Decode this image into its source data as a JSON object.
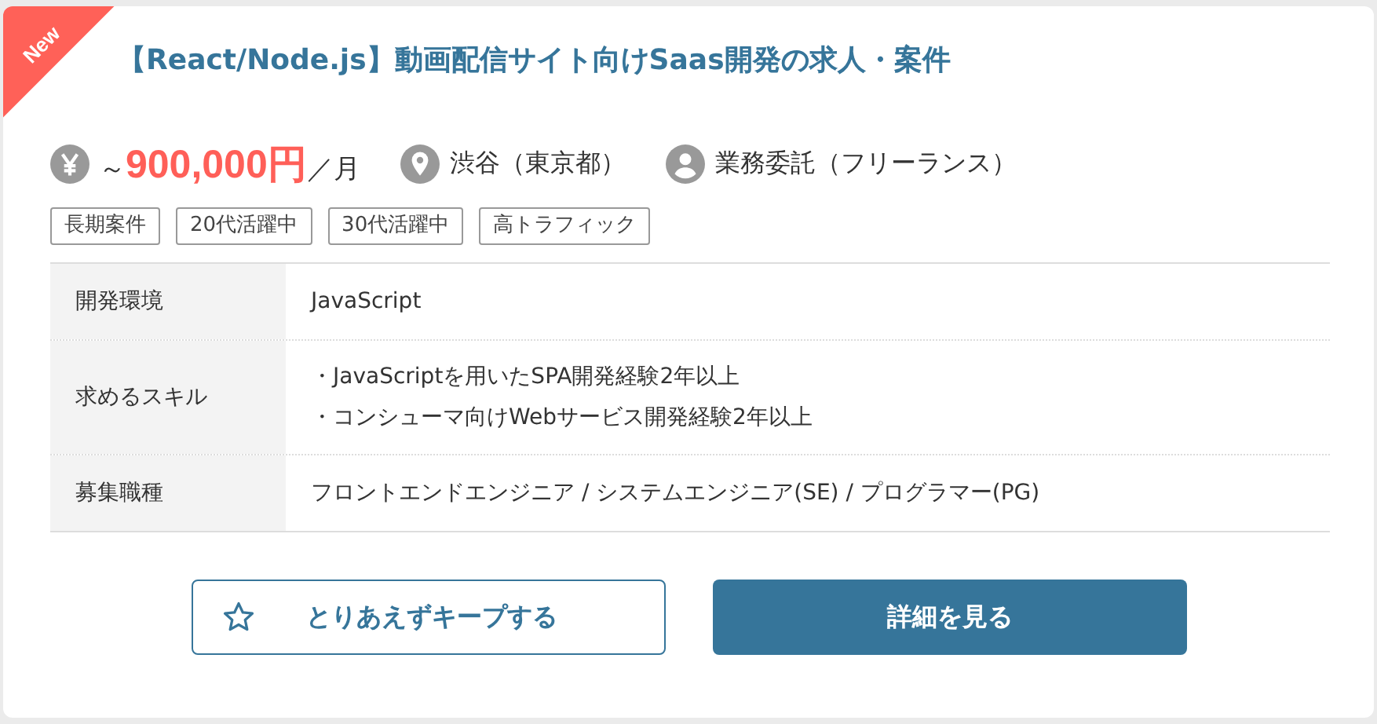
{
  "badge": "New",
  "title": "【React/Node.js】動画配信サイト向けSaas開発の求人・案件",
  "salary": {
    "prefix": "～",
    "amount": "900,000円",
    "unit": "／月"
  },
  "location": "渋谷（東京都）",
  "contract": "業務委託（フリーランス）",
  "tags": [
    "長期案件",
    "20代活躍中",
    "30代活躍中",
    "高トラフィック"
  ],
  "details": [
    {
      "label": "開発環境",
      "lines": [
        "JavaScript"
      ]
    },
    {
      "label": "求めるスキル",
      "lines": [
        "・JavaScriptを用いたSPA開発経験2年以上",
        "・コンシューマ向けWebサービス開発経験2年以上"
      ]
    },
    {
      "label": "募集職種",
      "lines": [
        "フロントエンドエンジニア / システムエンジニア(SE) / プログラマー(PG)"
      ]
    }
  ],
  "buttons": [
    {
      "kind": "outline",
      "label": "とりあえずキープする"
    },
    {
      "kind": "primary",
      "label": "詳細を見る"
    }
  ]
}
